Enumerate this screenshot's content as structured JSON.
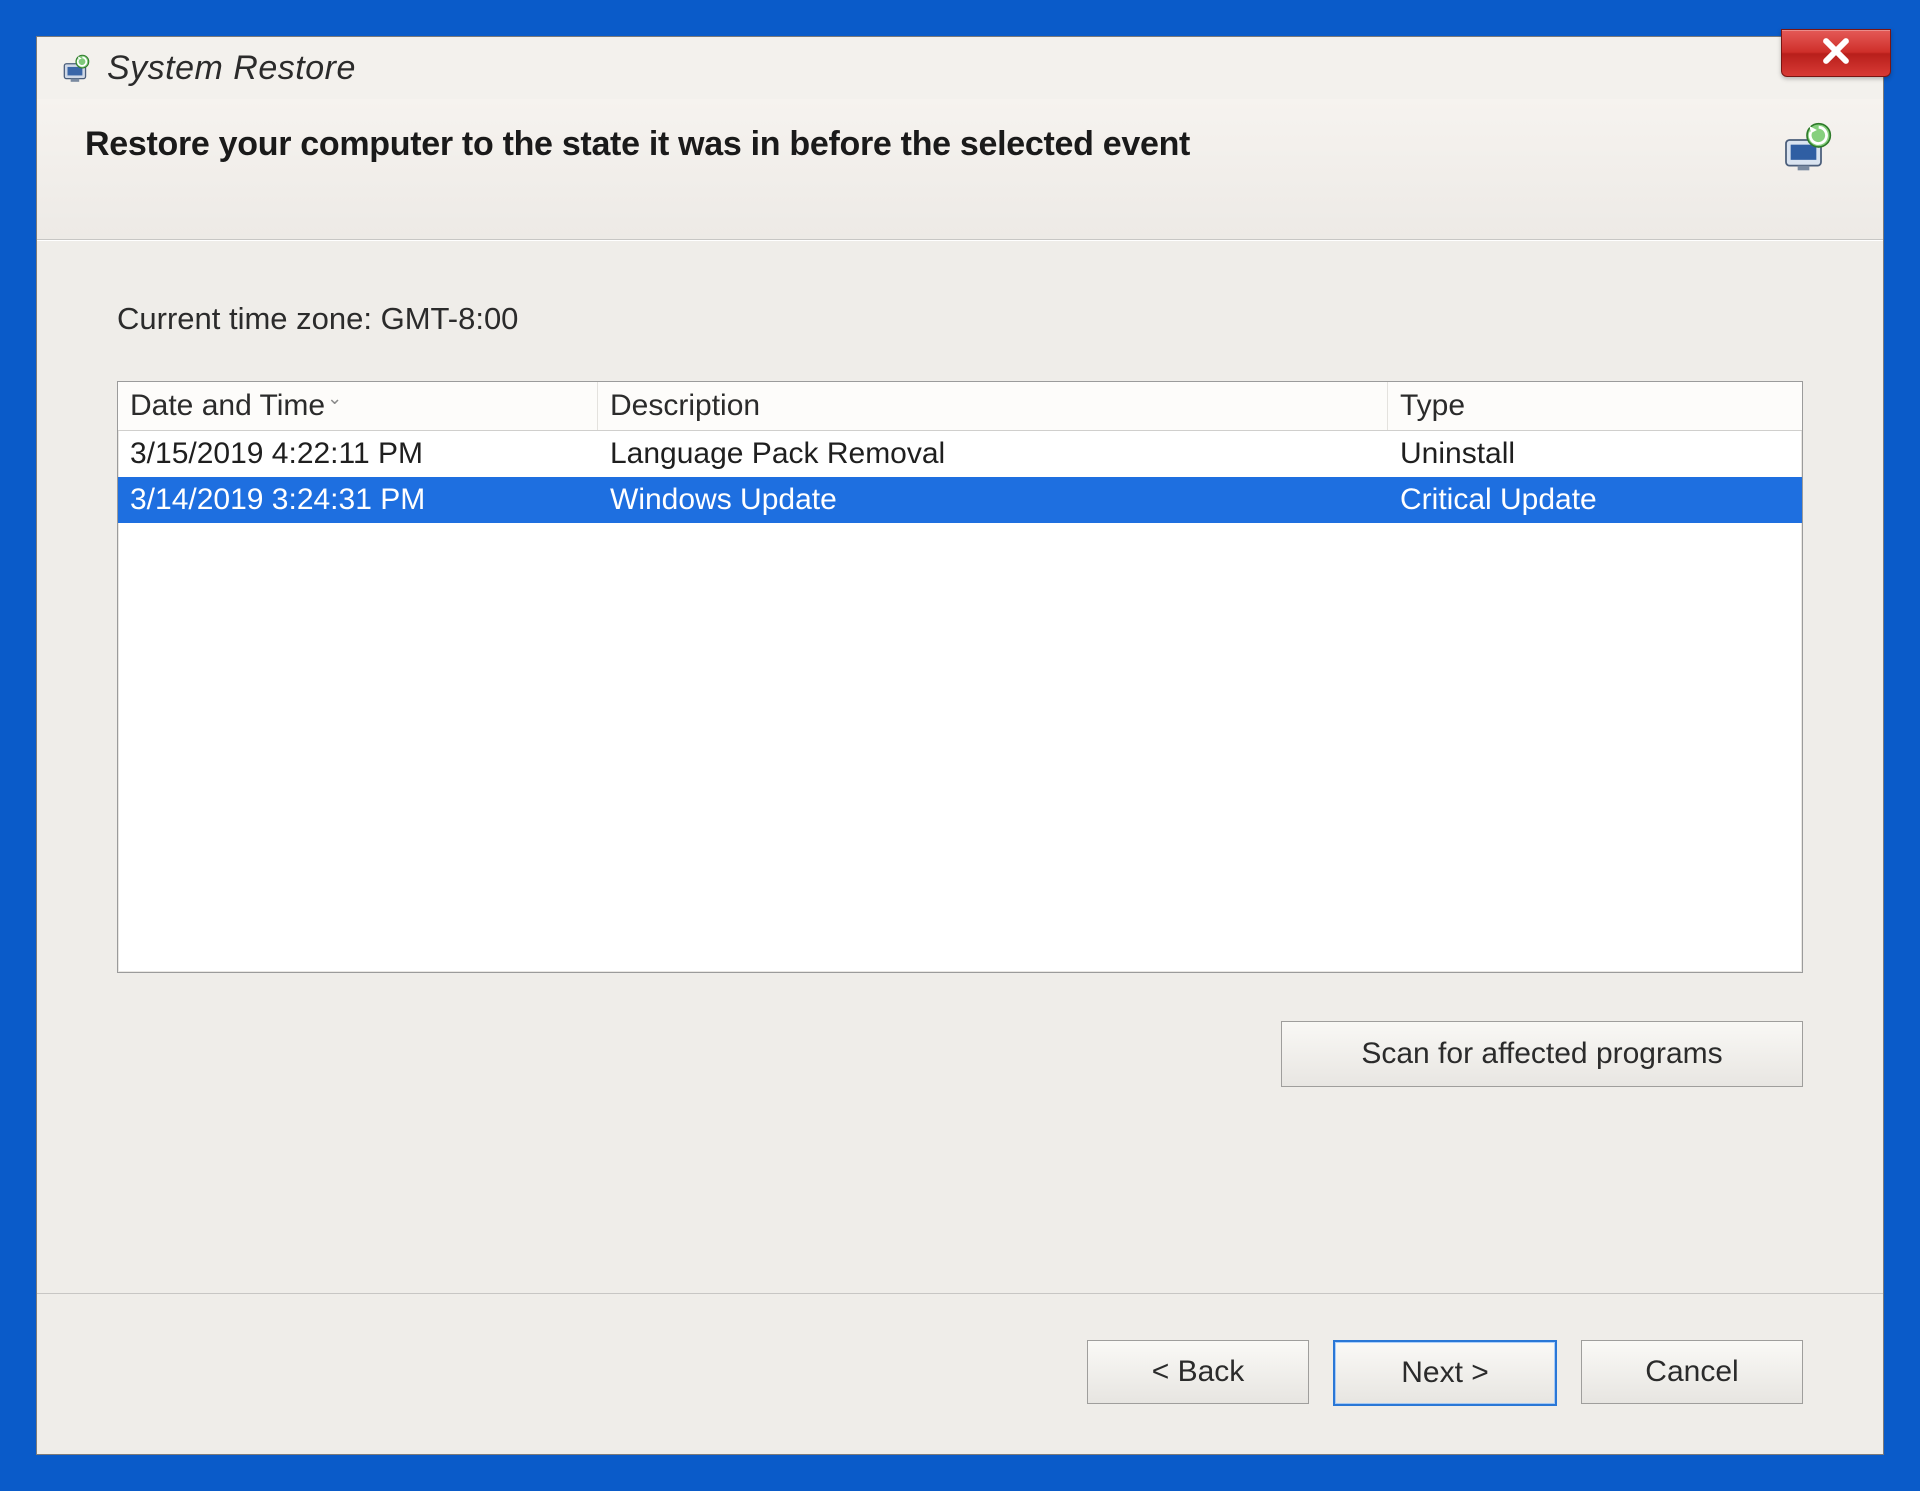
{
  "window": {
    "title": "System Restore"
  },
  "header": {
    "instruction": "Restore your computer to the state it was in before the selected event"
  },
  "content": {
    "timezone_label": "Current time zone: GMT-8:00",
    "columns": {
      "date": "Date and Time",
      "desc": "Description",
      "type": "Type"
    },
    "rows": [
      {
        "date": "3/15/2019 4:22:11 PM",
        "desc": "Language Pack Removal",
        "type": "Uninstall",
        "selected": false
      },
      {
        "date": "3/14/2019 3:24:31 PM",
        "desc": "Windows Update",
        "type": "Critical Update",
        "selected": true
      }
    ],
    "scan_label": "Scan for affected programs"
  },
  "footer": {
    "back": "< Back",
    "next": "Next >",
    "cancel": "Cancel"
  }
}
